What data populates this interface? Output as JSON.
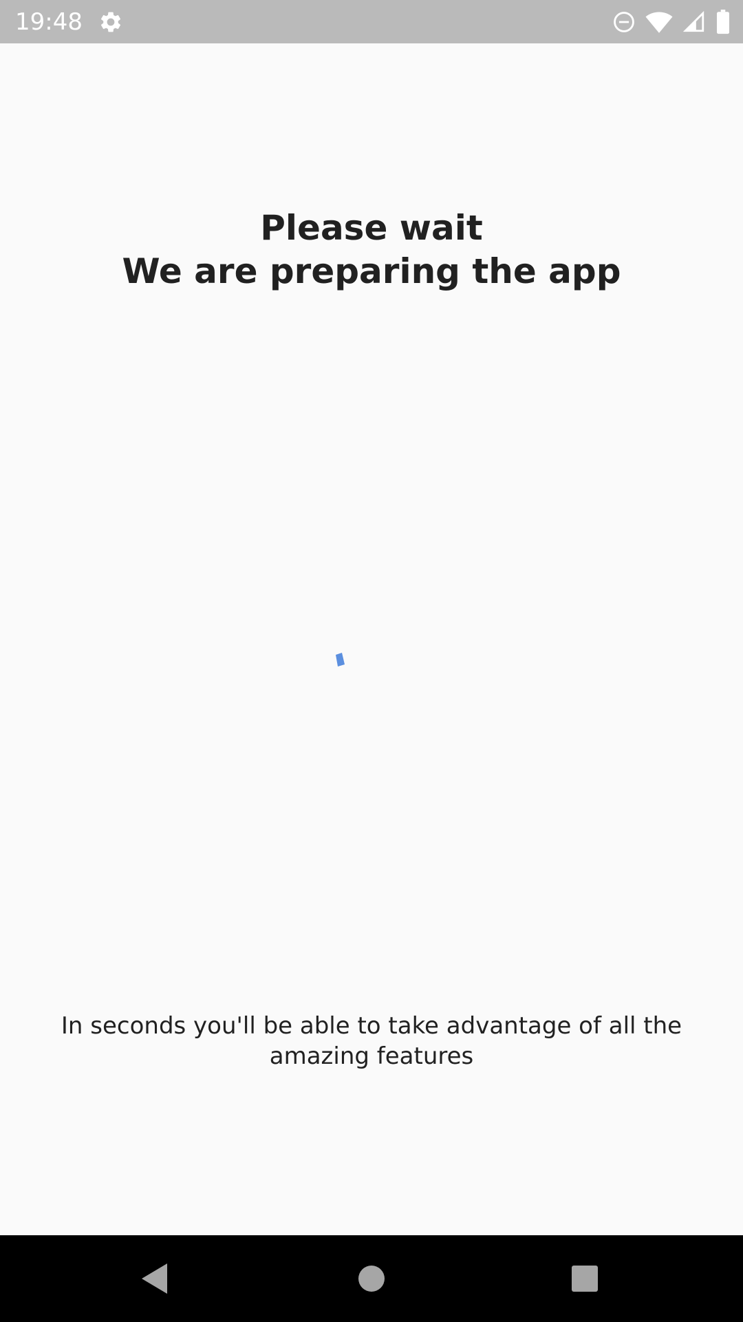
{
  "status_bar": {
    "time": "19:48",
    "icons": [
      "settings-gear-icon",
      "do-not-disturb-icon",
      "wifi-icon",
      "cell-signal-icon",
      "battery-icon"
    ],
    "background_color": "#bababa"
  },
  "loading_screen": {
    "title_line1": "Please wait",
    "title_line2": "We are preparing the app",
    "message": "In seconds you'll be able to take advantage of all the amazing features",
    "spinner_color": "#5b8fdf"
  },
  "nav_bar": {
    "buttons": [
      "back-icon",
      "home-icon",
      "recents-icon"
    ]
  }
}
